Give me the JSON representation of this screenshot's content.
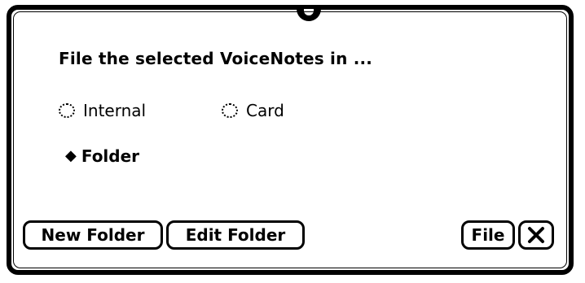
{
  "dialog": {
    "prompt": "File the selected VoiceNotes in ...",
    "options": {
      "internal_label": "Internal",
      "card_label": "Card"
    },
    "folder": {
      "marker": "◆",
      "label": "Folder"
    },
    "buttons": {
      "new_folder": "New Folder",
      "edit_folder": "Edit Folder",
      "file": "File"
    },
    "icons": {
      "close": "close-icon",
      "drag_tab": "drag-tab-icon"
    }
  }
}
